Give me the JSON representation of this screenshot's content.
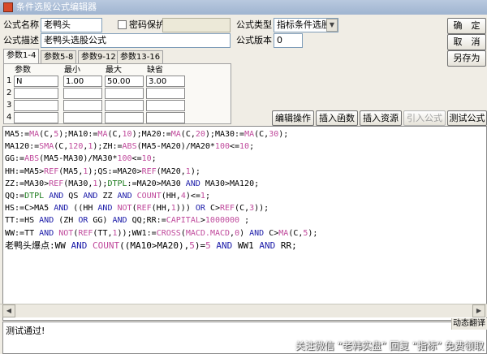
{
  "window": {
    "title": "条件选股公式编辑器"
  },
  "form": {
    "name_label": "公式名称",
    "name_value": "老鸭头",
    "password_label": "密码保护",
    "desc_label": "公式描述",
    "desc_value": "老鸭头选股公式",
    "type_label": "公式类型",
    "type_value": "指标条件选股",
    "version_label": "公式版本",
    "version_value": "0"
  },
  "buttons": {
    "ok": "确　定",
    "cancel": "取　消",
    "save_as": "另存为",
    "edit_op": "编辑操作",
    "insert_func": "插入函数",
    "insert_res": "插入资源",
    "import_formula": "引入公式",
    "test_formula": "测试公式"
  },
  "tabs": [
    "参数1-4",
    "参数5-8",
    "参数9-12",
    "参数13-16"
  ],
  "param_table": {
    "headers": [
      "参数",
      "最小",
      "最大",
      "缺省"
    ],
    "rows": [
      {
        "num": "1",
        "name": "N",
        "min": "1.00",
        "max": "50.00",
        "default": "3.00"
      },
      {
        "num": "2",
        "name": "",
        "min": "",
        "max": "",
        "default": ""
      },
      {
        "num": "3",
        "name": "",
        "min": "",
        "max": "",
        "default": ""
      },
      {
        "num": "4",
        "name": "",
        "min": "",
        "max": "",
        "default": ""
      }
    ]
  },
  "code_lines": [
    [
      [
        "MA5:=",
        ""
      ],
      [
        "MA",
        "fn"
      ],
      [
        "(C,",
        ""
      ],
      [
        "5",
        "num"
      ],
      [
        ");MA10:=",
        ""
      ],
      [
        "MA",
        "fn"
      ],
      [
        "(C,",
        ""
      ],
      [
        "10",
        "num"
      ],
      [
        ");MA20:=",
        ""
      ],
      [
        "MA",
        "fn"
      ],
      [
        "(C,",
        ""
      ],
      [
        "20",
        "num"
      ],
      [
        ");MA30:=",
        ""
      ],
      [
        "MA",
        "fn"
      ],
      [
        "(C,",
        ""
      ],
      [
        "30",
        "num"
      ],
      [
        ");",
        ""
      ]
    ],
    [
      [
        "MA120:=",
        ""
      ],
      [
        "SMA",
        "fn"
      ],
      [
        "(C,",
        ""
      ],
      [
        "120",
        "num"
      ],
      [
        ",",
        ""
      ],
      [
        "1",
        "num"
      ],
      [
        ");ZH:=",
        ""
      ],
      [
        "ABS",
        "fn"
      ],
      [
        "(MA5-MA20)/MA20*",
        ""
      ],
      [
        "100",
        "num"
      ],
      [
        "<=",
        ""
      ],
      [
        "10",
        "num"
      ],
      [
        ";",
        ""
      ]
    ],
    [
      [
        "GG:=",
        ""
      ],
      [
        "ABS",
        "fn"
      ],
      [
        "(MA5-MA30)/MA30*",
        ""
      ],
      [
        "100",
        "num"
      ],
      [
        "<=",
        ""
      ],
      [
        "10",
        "num"
      ],
      [
        ";",
        ""
      ]
    ],
    [
      [
        "HH:=MA5>",
        ""
      ],
      [
        "REF",
        "fn"
      ],
      [
        "(MA5,",
        ""
      ],
      [
        "1",
        "num"
      ],
      [
        ");QS:=MA20>",
        ""
      ],
      [
        "REF",
        "fn"
      ],
      [
        "(MA20,",
        ""
      ],
      [
        "1",
        "num"
      ],
      [
        ");",
        ""
      ]
    ],
    [
      [
        "ZZ:=MA30>",
        ""
      ],
      [
        "REF",
        "fn"
      ],
      [
        "(MA30,",
        ""
      ],
      [
        "1",
        "num"
      ],
      [
        ");",
        ""
      ],
      [
        "DTPL",
        "user"
      ],
      [
        ":=MA20>MA30 ",
        ""
      ],
      [
        "AND",
        "and"
      ],
      [
        " MA30>MA120;",
        ""
      ]
    ],
    [
      [
        "QQ:=",
        ""
      ],
      [
        "DTPL",
        "user"
      ],
      [
        " ",
        ""
      ],
      [
        "AND",
        "and"
      ],
      [
        " QS ",
        ""
      ],
      [
        "AND",
        "and"
      ],
      [
        " ZZ ",
        ""
      ],
      [
        "AND",
        "and"
      ],
      [
        " ",
        ""
      ],
      [
        "COUNT",
        "fn"
      ],
      [
        "(HH,",
        ""
      ],
      [
        "4",
        "num"
      ],
      [
        ")<=",
        ""
      ],
      [
        "1",
        "num"
      ],
      [
        ";",
        ""
      ]
    ],
    [
      [
        "HS:=C>MA5 ",
        ""
      ],
      [
        "AND",
        "and"
      ],
      [
        " ((HH ",
        ""
      ],
      [
        "AND",
        "and"
      ],
      [
        " ",
        ""
      ],
      [
        "NOT",
        "fn"
      ],
      [
        "(",
        ""
      ],
      [
        "REF",
        "fn"
      ],
      [
        "(HH,",
        ""
      ],
      [
        "1",
        "num"
      ],
      [
        "))) ",
        ""
      ],
      [
        "OR",
        "and"
      ],
      [
        " C>",
        ""
      ],
      [
        "REF",
        "fn"
      ],
      [
        "(C,",
        ""
      ],
      [
        "3",
        "num"
      ],
      [
        "));",
        ""
      ]
    ],
    [
      [
        "TT:=HS ",
        ""
      ],
      [
        "AND",
        "and"
      ],
      [
        " (ZH ",
        ""
      ],
      [
        "OR",
        "and"
      ],
      [
        " GG) ",
        ""
      ],
      [
        "AND",
        "and"
      ],
      [
        " QQ;RR:=",
        ""
      ],
      [
        "CAPITAL",
        "fn"
      ],
      [
        ">",
        ""
      ],
      [
        "1000000",
        "num"
      ],
      [
        " ;",
        ""
      ]
    ],
    [
      [
        "WW:=TT ",
        ""
      ],
      [
        "AND",
        "and"
      ],
      [
        " ",
        ""
      ],
      [
        "NOT",
        "fn"
      ],
      [
        "(",
        ""
      ],
      [
        "REF",
        "fn"
      ],
      [
        "(TT,",
        ""
      ],
      [
        "1",
        "num"
      ],
      [
        "));WW1:=",
        ""
      ],
      [
        "CROSS",
        "fn"
      ],
      [
        "(",
        ""
      ],
      [
        "MACD.MACD",
        "fn"
      ],
      [
        ",",
        ""
      ],
      [
        "0",
        "num"
      ],
      [
        ") ",
        ""
      ],
      [
        "AND",
        "and"
      ],
      [
        " C>",
        ""
      ],
      [
        "MA",
        "fn"
      ],
      [
        "(C,",
        ""
      ],
      [
        "5",
        "num"
      ],
      [
        ");",
        ""
      ]
    ],
    [
      [
        "老鸭头爆点:WW ",
        ""
      ],
      [
        "AND",
        "and"
      ],
      [
        " ",
        ""
      ],
      [
        "COUNT",
        "fn"
      ],
      [
        "((MA10>MA20),",
        ""
      ],
      [
        "5",
        "num"
      ],
      [
        ")=",
        ""
      ],
      [
        "5",
        "num"
      ],
      [
        " ",
        ""
      ],
      [
        "AND",
        "and"
      ],
      [
        " WW1 ",
        ""
      ],
      [
        "AND",
        "and"
      ],
      [
        " RR;",
        ""
      ]
    ]
  ],
  "status": {
    "text": "测试通过!",
    "side_tag": "动态翻译"
  },
  "watermark": "关注微信 “老韩实盘” 回复 “指标” 免费领取"
}
